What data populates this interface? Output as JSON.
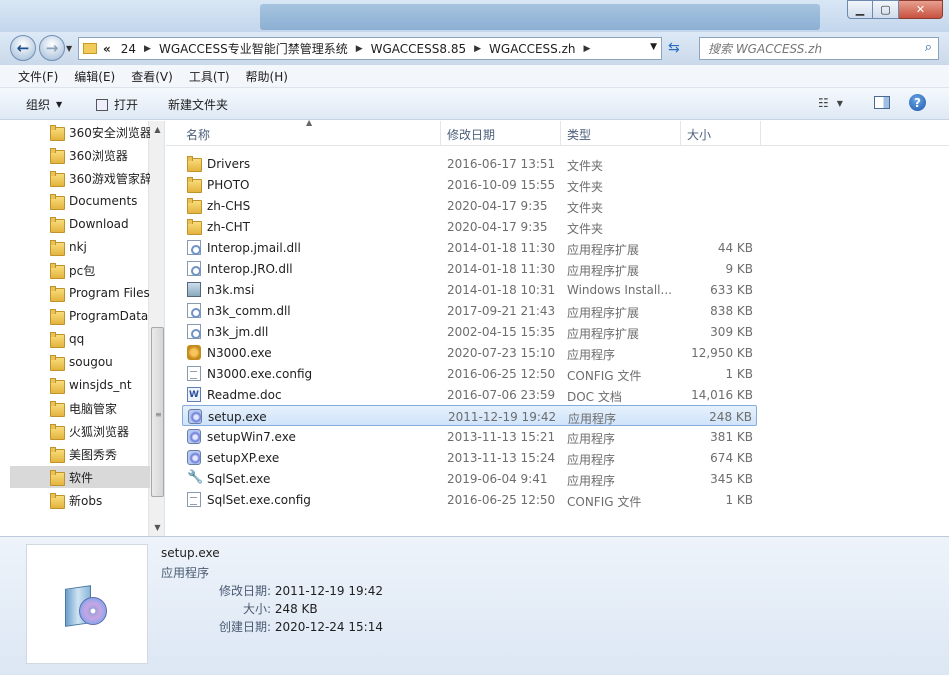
{
  "title_bar": {
    "buttons": [
      "minimize",
      "maximize",
      "close"
    ]
  },
  "address_bar": {
    "overflow": "«",
    "crumbs": [
      "24",
      "WGACCESS专业智能门禁管理系统",
      "WGACCESS8.85",
      "WGACCESS.zh"
    ],
    "search_placeholder": "搜索 WGACCESS.zh"
  },
  "menu": {
    "items": [
      "文件(F)",
      "编辑(E)",
      "查看(V)",
      "工具(T)",
      "帮助(H)"
    ]
  },
  "toolbar": {
    "organize": "组织",
    "open": "打开",
    "new_folder": "新建文件夹"
  },
  "nav_pane": {
    "items": [
      "360安全浏览器",
      "360浏览器",
      "360游戏管家辞",
      "Documents",
      "Download",
      "nkj",
      "pc包",
      "Program Files",
      "ProgramData",
      "qq",
      "sougou",
      "winsjds_nt",
      "电脑管家",
      "火狐浏览器",
      "美图秀秀",
      "软件",
      "新obs"
    ],
    "selected": "软件"
  },
  "columns": [
    "名称",
    "修改日期",
    "类型",
    "大小"
  ],
  "files": [
    {
      "name": "Drivers",
      "date": "2016-06-17 13:51",
      "type": "文件夹",
      "size": "",
      "icon": "folder-icon"
    },
    {
      "name": "PHOTO",
      "date": "2016-10-09 15:55",
      "type": "文件夹",
      "size": "",
      "icon": "folder-icon"
    },
    {
      "name": "zh-CHS",
      "date": "2020-04-17 9:35",
      "type": "文件夹",
      "size": "",
      "icon": "folder-icon"
    },
    {
      "name": "zh-CHT",
      "date": "2020-04-17 9:35",
      "type": "文件夹",
      "size": "",
      "icon": "folder-icon"
    },
    {
      "name": "Interop.jmail.dll",
      "date": "2014-01-18 11:30",
      "type": "应用程序扩展",
      "size": "44 KB",
      "icon": "dll-icon"
    },
    {
      "name": "Interop.JRO.dll",
      "date": "2014-01-18 11:30",
      "type": "应用程序扩展",
      "size": "9 KB",
      "icon": "dll-icon"
    },
    {
      "name": "n3k.msi",
      "date": "2014-01-18 10:31",
      "type": "Windows Install...",
      "size": "633 KB",
      "icon": "msi-icon"
    },
    {
      "name": "n3k_comm.dll",
      "date": "2017-09-21 21:43",
      "type": "应用程序扩展",
      "size": "838 KB",
      "icon": "dll-icon"
    },
    {
      "name": "n3k_jm.dll",
      "date": "2002-04-15 15:35",
      "type": "应用程序扩展",
      "size": "309 KB",
      "icon": "dll-icon"
    },
    {
      "name": "N3000.exe",
      "date": "2020-07-23 15:10",
      "type": "应用程序",
      "size": "12,950 KB",
      "icon": "app-icon"
    },
    {
      "name": "N3000.exe.config",
      "date": "2016-06-25 12:50",
      "type": "CONFIG 文件",
      "size": "1 KB",
      "icon": "document-icon"
    },
    {
      "name": "Readme.doc",
      "date": "2016-07-06 23:59",
      "type": "DOC 文档",
      "size": "14,016 KB",
      "icon": "word-doc-icon"
    },
    {
      "name": "setup.exe",
      "date": "2011-12-19 19:42",
      "type": "应用程序",
      "size": "248 KB",
      "icon": "setup-icon"
    },
    {
      "name": "setupWin7.exe",
      "date": "2013-11-13 15:21",
      "type": "应用程序",
      "size": "381 KB",
      "icon": "setup-icon"
    },
    {
      "name": "setupXP.exe",
      "date": "2013-11-13 15:24",
      "type": "应用程序",
      "size": "674 KB",
      "icon": "setup-icon"
    },
    {
      "name": "SqlSet.exe",
      "date": "2019-06-04 9:41",
      "type": "应用程序",
      "size": "345 KB",
      "icon": "wrench-icon"
    },
    {
      "name": "SqlSet.exe.config",
      "date": "2016-06-25 12:50",
      "type": "CONFIG 文件",
      "size": "1 KB",
      "icon": "document-icon"
    }
  ],
  "selected_file": "setup.exe",
  "details": {
    "name": "setup.exe",
    "type": "应用程序",
    "modified_label": "修改日期:",
    "modified": "2011-12-19 19:42",
    "size_label": "大小:",
    "size": "248 KB",
    "created_label": "创建日期:",
    "created": "2020-12-24 15:14"
  }
}
